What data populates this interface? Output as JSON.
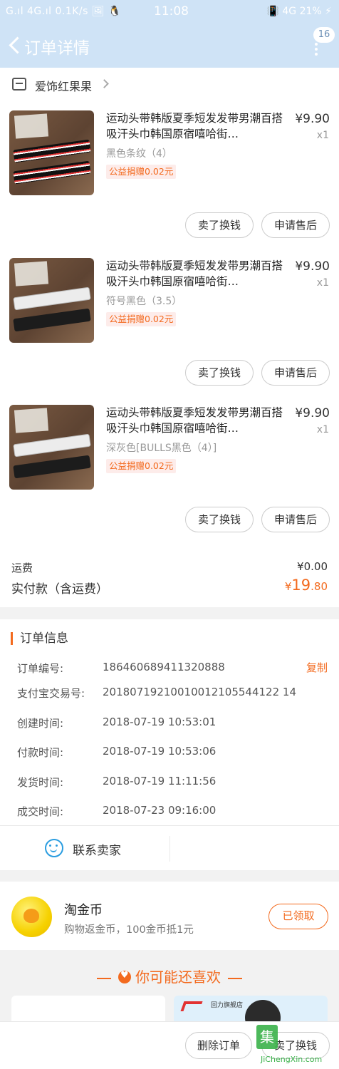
{
  "status_bar": {
    "left": "G.ıl 4G.ıl 0.1K/s 🖼 🐧",
    "time": "11:08",
    "right": "📳 4G 21% ⚡"
  },
  "header": {
    "title": "订单详情",
    "badge": "16"
  },
  "shop": {
    "name": "爱饰红果果"
  },
  "items": [
    {
      "title": "运动头带韩版夏季短发发带男潮百搭吸汗头巾韩国原宿嘻哈街…",
      "price": "¥9.90",
      "qty": "x1",
      "spec": "黑色条纹（4）",
      "charity": "公益捐赠0.02元",
      "btn_sell": "卖了换钱",
      "btn_after": "申请售后"
    },
    {
      "title": "运动头带韩版夏季短发发带男潮百搭吸汗头巾韩国原宿嘻哈街…",
      "price": "¥9.90",
      "qty": "x1",
      "spec": "符号黑色（3.5）",
      "charity": "公益捐赠0.02元",
      "btn_sell": "卖了换钱",
      "btn_after": "申请售后"
    },
    {
      "title": "运动头带韩版夏季短发发带男潮百搭吸汗头巾韩国原宿嘻哈街…",
      "price": "¥9.90",
      "qty": "x1",
      "spec": "深灰色[BULLS黑色（4）]",
      "charity": "公益捐赠0.02元",
      "btn_sell": "卖了换钱",
      "btn_after": "申请售后"
    }
  ],
  "summary": {
    "shipping_label": "运费",
    "shipping_value": "¥0.00",
    "paid_label": "实付款（含运费）",
    "paid_currency": "¥",
    "paid_int": "19",
    "paid_dec": ".80"
  },
  "order_info": {
    "title": "订单信息",
    "copy_label": "复制",
    "rows": [
      {
        "k": "订单编号:",
        "v": "186460689411320888"
      },
      {
        "k": "支付宝交易号:",
        "v": "20180719210010012105544122 14"
      },
      {
        "k": "创建时间:",
        "v": "2018-07-19 10:53:01"
      },
      {
        "k": "付款时间:",
        "v": "2018-07-19 10:53:06"
      },
      {
        "k": "发货时间:",
        "v": "2018-07-19 11:11:56"
      },
      {
        "k": "成交时间:",
        "v": "2018-07-23 09:16:00"
      }
    ],
    "contact_label": "联系卖家"
  },
  "coin": {
    "title": "淘金币",
    "subtitle": "购物返金币，100金币抵1元",
    "button": "已领取"
  },
  "recommend": {
    "title": "你可能还喜欢",
    "card2_store": "回力旗舰店"
  },
  "bottom_bar": {
    "delete": "删除订单",
    "sell": "卖了换钱"
  },
  "watermark": {
    "glyph": "集",
    "text": "JiChengXin.com"
  }
}
